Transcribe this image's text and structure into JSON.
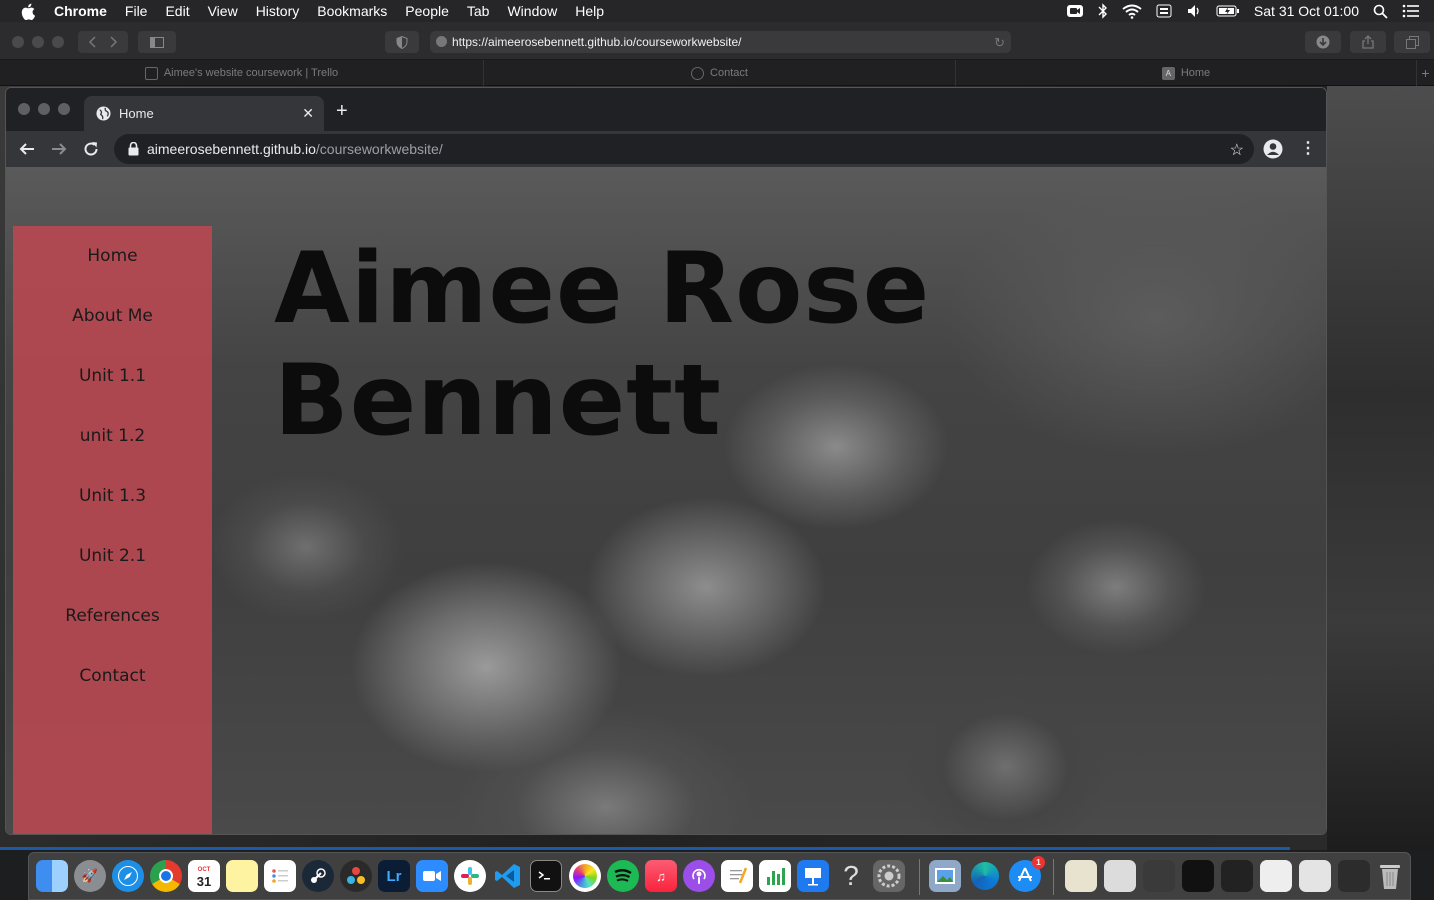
{
  "menubar": {
    "items": [
      "Chrome",
      "File",
      "Edit",
      "View",
      "History",
      "Bookmarks",
      "People",
      "Tab",
      "Window",
      "Help"
    ],
    "clock": "Sat 31 Oct  01:00",
    "status_icons": [
      "zoom-icon",
      "bluetooth-icon",
      "wifi-icon",
      "keyboard-icon",
      "volume-icon",
      "battery-icon",
      "spotlight-icon",
      "notification-center-icon"
    ]
  },
  "outer_window": {
    "url": "https://aimeerosebennett.github.io/courseworkwebsite/",
    "tabs": [
      {
        "label": "Aimee's website coursework | Trello",
        "icon": "trello-icon"
      },
      {
        "label": "Contact",
        "icon": "compass-icon"
      },
      {
        "label": "Home",
        "icon": "a-icon",
        "icon_letter": "A"
      }
    ]
  },
  "chrome": {
    "tab_title": "Home",
    "url_host": "aimeerosebennett.github.io",
    "url_path": "/courseworkwebsite/"
  },
  "site": {
    "title_line1": "Aimee Rose",
    "title_line2": "Bennett",
    "nav": [
      "Home",
      "About Me",
      "Unit 1.1",
      "unit 1.2",
      "Unit 1.3",
      "Unit 2.1",
      "References",
      "Contact"
    ]
  },
  "dock": {
    "apps": [
      "finder",
      "launchpad",
      "safari",
      "chrome",
      "calendar",
      "notes",
      "reminders",
      "steam",
      "davinci-resolve",
      "lightroom",
      "zoom",
      "slack",
      "vscode",
      "terminal",
      "photos",
      "spotify",
      "music",
      "podcasts",
      "textedit",
      "numbers",
      "keynote",
      "help",
      "system-preferences",
      "preview",
      "edge",
      "app-store"
    ],
    "calendar_month": "OCT",
    "calendar_day": "31",
    "lightroom_label": "Lr",
    "app_store_badge": "1"
  }
}
